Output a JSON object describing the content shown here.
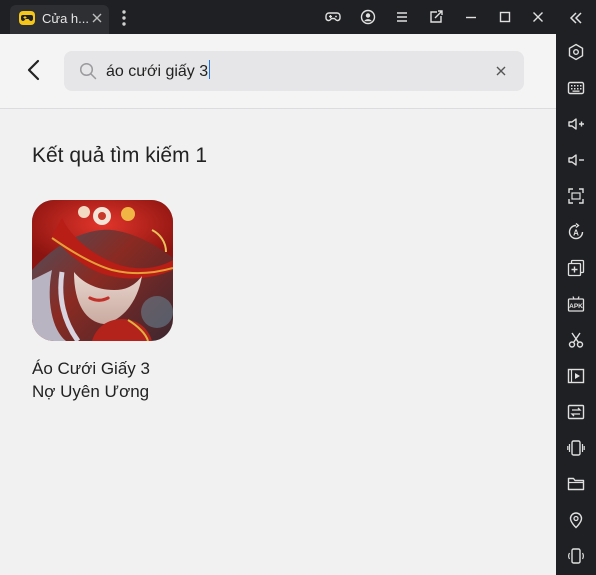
{
  "window": {
    "tab_title": "Cửa h...",
    "tab_icon": "gamepad-icon",
    "controls": [
      "gamepad-icon",
      "account-icon",
      "menu-icon",
      "screen-export-icon",
      "minimize-icon",
      "maximize-icon",
      "close-icon"
    ]
  },
  "search": {
    "query": "áo cưới giấy 3"
  },
  "results": {
    "heading": "Kết quả tìm kiếm 1",
    "apps": [
      {
        "name": "Áo Cưới Giấy 3\nNợ Uyên Ương",
        "icon": "red-veiled-bride-artwork"
      }
    ]
  },
  "sidebar": {
    "items": [
      "settings-hexagon-icon",
      "keyboard-icon",
      "volume-up-icon",
      "volume-down-icon",
      "fullscreen-icon",
      "auto-rotate-icon",
      "add-app-icon",
      "apk-install-icon",
      "screenshot-scissors-icon",
      "record-video-icon",
      "sync-icon",
      "shake-icon",
      "folder-icon",
      "location-icon",
      "rotate-device-icon"
    ]
  },
  "colors": {
    "accent": "#f5c518",
    "chrome": "#1f2023",
    "content_bg": "#f1f1f2",
    "caret": "#1a73e8"
  }
}
